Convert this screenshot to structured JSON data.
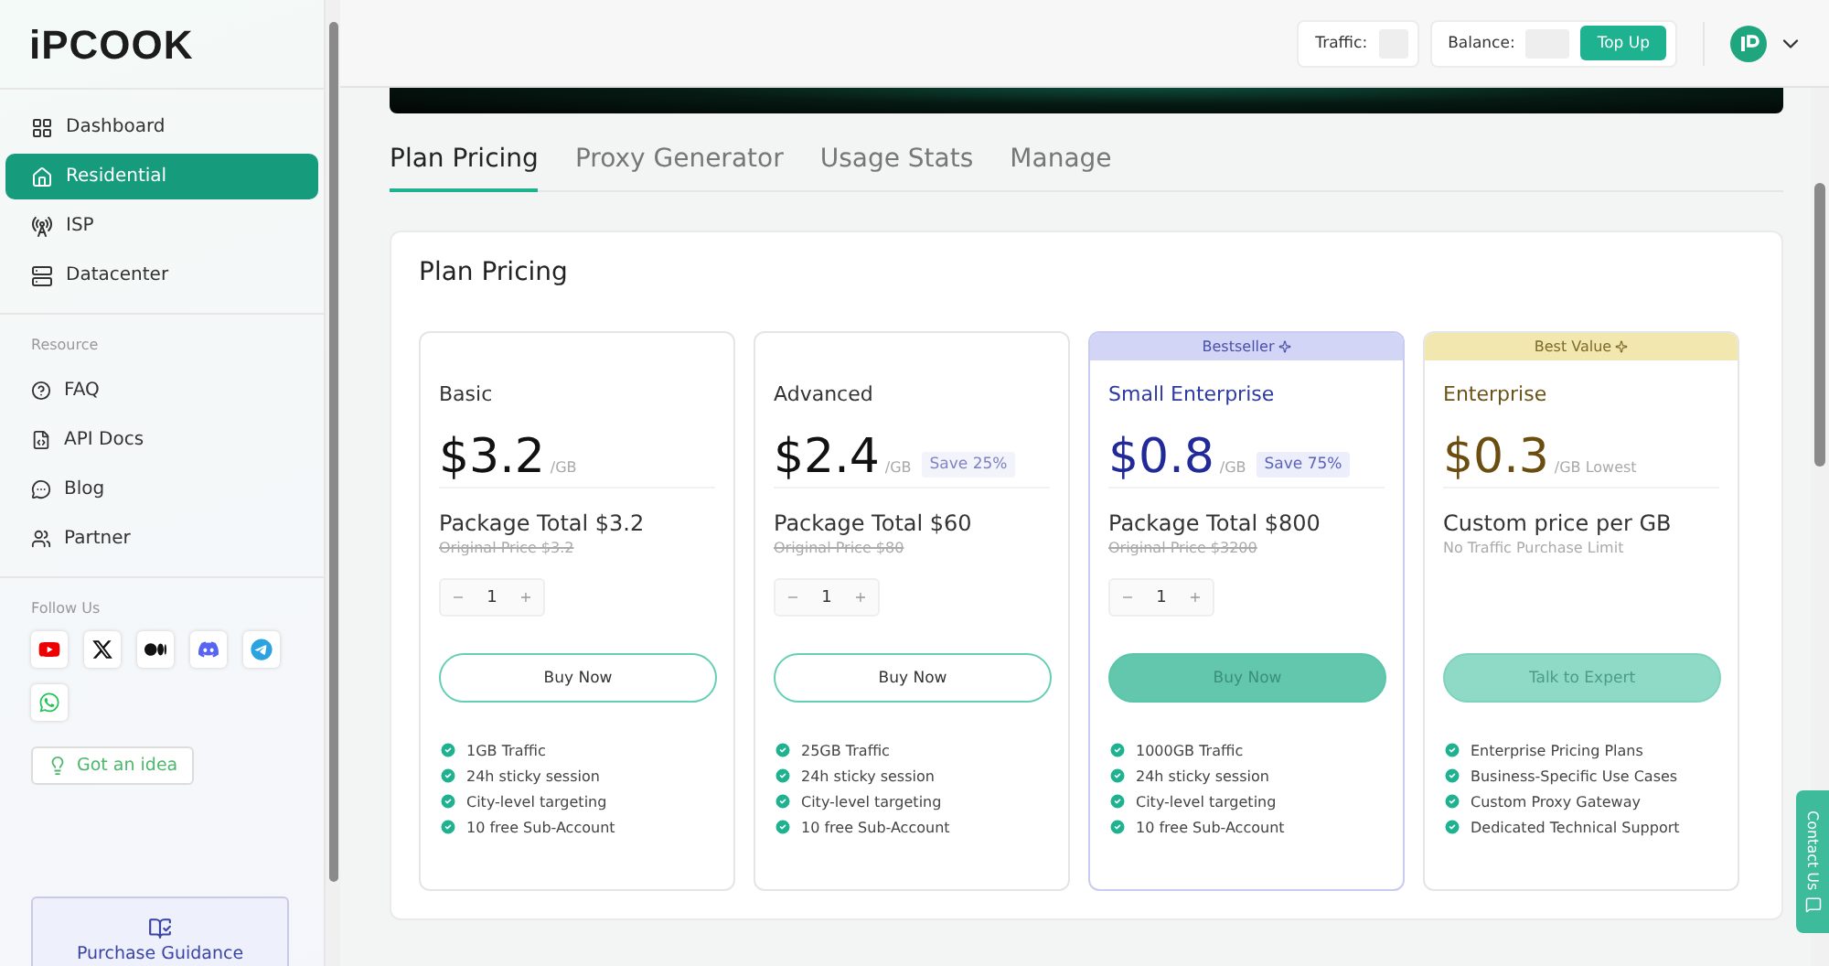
{
  "sidebar": {
    "logo": "iPCOOK",
    "nav": [
      {
        "label": "Dashboard",
        "selected": false
      },
      {
        "label": "Residential",
        "selected": true
      },
      {
        "label": "ISP",
        "selected": false
      },
      {
        "label": "Datacenter",
        "selected": false
      }
    ],
    "resource_heading": "Resource",
    "resources": [
      {
        "label": "FAQ"
      },
      {
        "label": "API Docs"
      },
      {
        "label": "Blog"
      },
      {
        "label": "Partner"
      }
    ],
    "follow_heading": "Follow Us",
    "idea_button": "Got an idea",
    "guidance": "Purchase Guidance"
  },
  "header": {
    "traffic_label": "Traffic:",
    "balance_label": "Balance:",
    "top_up": "Top Up"
  },
  "tabs": [
    {
      "label": "Plan Pricing",
      "selected": true
    },
    {
      "label": "Proxy Generator",
      "selected": false
    },
    {
      "label": "Usage Stats",
      "selected": false
    },
    {
      "label": "Manage",
      "selected": false
    }
  ],
  "panel_title": "Plan Pricing",
  "plans": [
    {
      "kind": "standard",
      "name": "Basic",
      "price": "$3.2",
      "unit": "/GB",
      "total": "Package Total $3.2",
      "original_price": "Original Price $3.2",
      "stepper": {
        "minus": "−",
        "quantity": "1",
        "plus": "+"
      },
      "button": {
        "label": "Buy Now",
        "kind": "outline"
      },
      "features": [
        "1GB Traffic",
        "24h sticky session",
        "City-level targeting",
        "10 free Sub-Account"
      ]
    },
    {
      "kind": "standard",
      "name": "Advanced",
      "price": "$2.4",
      "unit": "/GB",
      "save": "Save 25%",
      "total": "Package Total $60",
      "original_price": "Original Price $80",
      "stepper": {
        "minus": "−",
        "quantity": "1",
        "plus": "+"
      },
      "button": {
        "label": "Buy Now",
        "kind": "outline"
      },
      "features": [
        "25GB Traffic",
        "24h sticky session",
        "City-level targeting",
        "10 free Sub-Account"
      ]
    },
    {
      "kind": "bestseller",
      "badge": "Bestseller",
      "name": "Small Enterprise",
      "price": "$0.8",
      "unit": "/GB",
      "save": "Save 75%",
      "total": "Package Total $800",
      "original_price": "Original Price $3200",
      "stepper": {
        "minus": "−",
        "quantity": "1",
        "plus": "+"
      },
      "button": {
        "label": "Buy Now",
        "kind": "filled"
      },
      "features": [
        "1000GB Traffic",
        "24h sticky session",
        "City-level targeting",
        "10 free Sub-Account"
      ]
    },
    {
      "kind": "best_value",
      "badge": "Best Value",
      "name": "Enterprise",
      "price": "$0.3",
      "unit": "/GB Lowest",
      "total": "Custom price per GB",
      "note": "No Traffic Purchase Limit",
      "button": {
        "label": "Talk to Expert",
        "kind": "soft"
      },
      "features": [
        "Enterprise Pricing Plans",
        "Business-Specific Use Cases",
        "Custom Proxy Gateway",
        "Dedicated Technical Support"
      ]
    }
  ],
  "contact_tab": "Contact Us"
}
